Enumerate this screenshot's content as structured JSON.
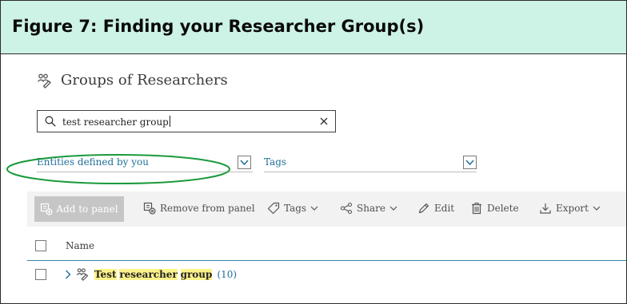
{
  "caption": "Figure 7: Finding your Researcher Group(s)",
  "page": {
    "title": "Groups of Researchers",
    "icon": "researchers-group-icon"
  },
  "search": {
    "value": "test researcher group",
    "icon": "search-icon",
    "clear_icon": "close-icon"
  },
  "filters": [
    {
      "label": "Entities defined by you",
      "dropdown_icon": "chevron-down-icon"
    },
    {
      "label": "Tags",
      "dropdown_icon": "chevron-down-icon"
    }
  ],
  "toolbar": {
    "add_to_panel": "Add to panel",
    "remove_from_panel": "Remove from panel",
    "tags": "Tags",
    "share": "Share",
    "edit": "Edit",
    "delete": "Delete",
    "export": "Export"
  },
  "table": {
    "column_name": "Name",
    "rows": [
      {
        "name_parts": [
          "Test",
          "researcher",
          "group"
        ],
        "count": "(10)"
      }
    ]
  },
  "colors": {
    "caption_bg": "#cdf2e6",
    "link_blue": "#1f6f99",
    "highlight_yellow": "#fbf28a",
    "annotation_green": "#1a9a3c",
    "table_rule": "#2d86a0"
  }
}
